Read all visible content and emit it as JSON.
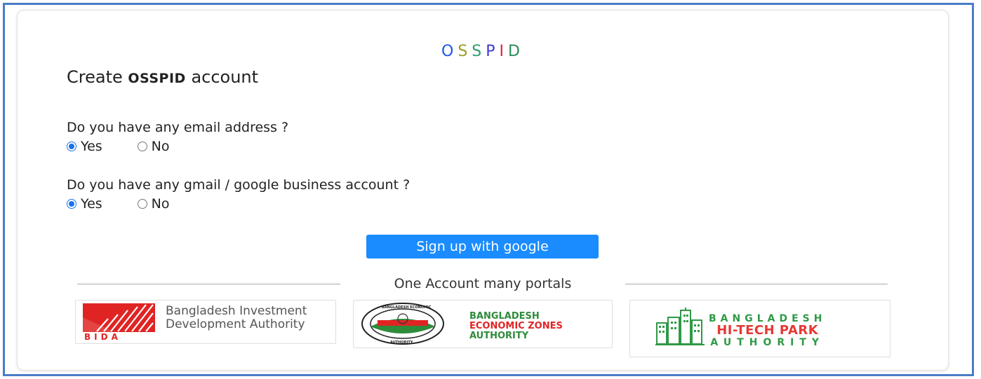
{
  "logo": {
    "letters": [
      "O",
      "S",
      "S",
      "P",
      "I",
      "D"
    ],
    "colors": [
      "#1a57e8",
      "#9c9c28",
      "#2a9d6e",
      "#3b3bd1",
      "#e0203a",
      "#2a8a55"
    ]
  },
  "heading": {
    "prefix": "Create ",
    "brand": "OSSPID",
    "suffix": " account"
  },
  "question1": {
    "text": "Do you have any email address ?",
    "options": [
      {
        "label": "Yes",
        "checked": true
      },
      {
        "label": "No",
        "checked": false
      }
    ]
  },
  "question2": {
    "text": "Do you have any gmail / google business account ?",
    "options": [
      {
        "label": "Yes",
        "checked": true
      },
      {
        "label": "No",
        "checked": false
      }
    ]
  },
  "signup_button": {
    "label": "Sign up with google",
    "color": "#1a8cff"
  },
  "divider_text": "One Account many portals",
  "portals": {
    "bida": {
      "name_line1": "Bangladesh Investment",
      "name_line2": "Development Authority",
      "abbr": "BIDA",
      "color": "#e02424"
    },
    "beza": {
      "seal_text": "BANGLADESH ECONOMIC ZONES AUTHORITY",
      "line1": "BANGLADESH",
      "line2": "ECONOMIC ZONES",
      "line3": "AUTHORITY",
      "green": "#2e8b3a",
      "red": "#e02424"
    },
    "htpa": {
      "line1": "BANGLADESH",
      "line2": "HI-TECH PARK",
      "line3": "AUTHORITY",
      "green": "#2e9a46",
      "red": "#e53935"
    }
  }
}
